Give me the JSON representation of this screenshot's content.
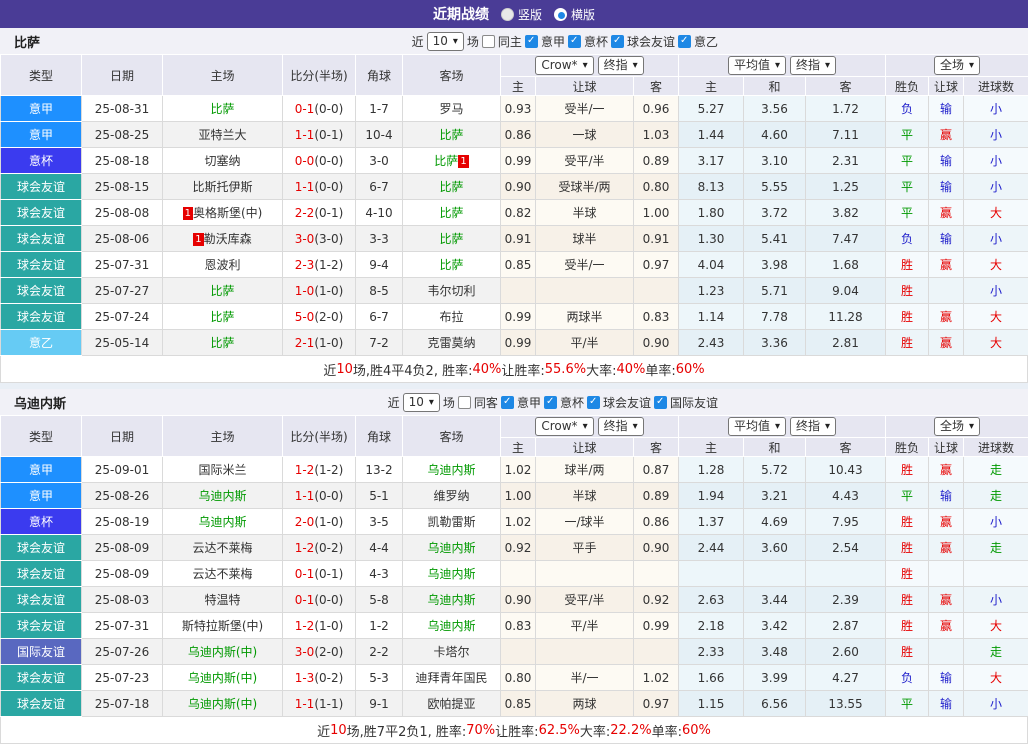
{
  "topbar": {
    "title": "近期战绩",
    "radios": [
      {
        "label": "竖版",
        "checked": false
      },
      {
        "label": "横版",
        "checked": true
      }
    ]
  },
  "league_colors": {
    "意甲": "#1E90FF",
    "意杯": "#3B3BEF",
    "球会友谊": "#2AA7A3",
    "意乙": "#66CBF4",
    "国际友谊": "#5968C0"
  },
  "result_colors": {
    "胜": "#E60000",
    "平": "#009900",
    "负": "#2222CC",
    "赢": "#E60000",
    "输": "#2222CC",
    "大": "#E60000",
    "小": "#2222CC",
    "走": "#009900"
  },
  "table_header": {
    "left_cols": [
      "类型",
      "日期",
      "主场",
      "比分(半场)",
      "角球",
      "客场"
    ],
    "group1": {
      "selects": [
        "Crow*",
        "终指"
      ],
      "cols": [
        "主",
        "让球",
        "客"
      ]
    },
    "group2": {
      "selects": [
        "平均值",
        "终指"
      ],
      "cols": [
        "主",
        "和",
        "客"
      ]
    },
    "group3": {
      "selects": [
        "全场"
      ],
      "cols": [
        "胜负",
        "让球",
        "进球数"
      ]
    }
  },
  "sections": [
    {
      "team": "比萨",
      "filter": {
        "near_label": "近",
        "count": "10",
        "games_label": "场",
        "same": {
          "label": "同主",
          "checked": false
        },
        "leagues": [
          {
            "label": "意甲",
            "checked": true
          },
          {
            "label": "意杯",
            "checked": true
          },
          {
            "label": "球会友谊",
            "checked": true
          },
          {
            "label": "意乙",
            "checked": true
          }
        ]
      },
      "rows": [
        {
          "league": "意甲",
          "date": "25-08-31",
          "home": {
            "name": "比萨",
            "green": true
          },
          "score": "0-1",
          "half": "(0-0)",
          "corner": "1-7",
          "away": {
            "name": "罗马",
            "green": false
          },
          "odds": [
            "0.93",
            "受半/一",
            "0.96"
          ],
          "avg": [
            "5.27",
            "3.56",
            "1.72"
          ],
          "results": [
            "负",
            "输",
            "小"
          ]
        },
        {
          "league": "意甲",
          "date": "25-08-25",
          "home": {
            "name": "亚特兰大",
            "green": false
          },
          "score": "1-1",
          "half": "(0-1)",
          "corner": "10-4",
          "away": {
            "name": "比萨",
            "green": true
          },
          "odds": [
            "0.86",
            "一球",
            "1.03"
          ],
          "avg": [
            "1.44",
            "4.60",
            "7.11"
          ],
          "results": [
            "平",
            "赢",
            "小"
          ]
        },
        {
          "league": "意杯",
          "date": "25-08-18",
          "home": {
            "name": "切塞纳",
            "green": false
          },
          "score": "0-0",
          "half": "(0-0)",
          "corner": "3-0",
          "away": {
            "name": "比萨",
            "green": true,
            "badge_after": "1"
          },
          "odds": [
            "0.99",
            "受平/半",
            "0.89"
          ],
          "avg": [
            "3.17",
            "3.10",
            "2.31"
          ],
          "results": [
            "平",
            "输",
            "小"
          ]
        },
        {
          "league": "球会友谊",
          "date": "25-08-15",
          "home": {
            "name": "比斯托伊斯",
            "green": false
          },
          "score": "1-1",
          "half": "(0-0)",
          "corner": "6-7",
          "away": {
            "name": "比萨",
            "green": true
          },
          "odds": [
            "0.90",
            "受球半/两",
            "0.80"
          ],
          "avg": [
            "8.13",
            "5.55",
            "1.25"
          ],
          "results": [
            "平",
            "输",
            "小"
          ]
        },
        {
          "league": "球会友谊",
          "date": "25-08-08",
          "home": {
            "name": "奥格斯堡(中)",
            "green": false,
            "badge_before": "1"
          },
          "score": "2-2",
          "half": "(0-1)",
          "corner": "4-10",
          "away": {
            "name": "比萨",
            "green": true
          },
          "odds": [
            "0.82",
            "半球",
            "1.00"
          ],
          "avg": [
            "1.80",
            "3.72",
            "3.82"
          ],
          "results": [
            "平",
            "赢",
            "大"
          ]
        },
        {
          "league": "球会友谊",
          "date": "25-08-06",
          "home": {
            "name": "勒沃库森",
            "green": false,
            "badge_before": "1"
          },
          "score": "3-0",
          "half": "(3-0)",
          "corner": "3-3",
          "away": {
            "name": "比萨",
            "green": true
          },
          "odds": [
            "0.91",
            "球半",
            "0.91"
          ],
          "avg": [
            "1.30",
            "5.41",
            "7.47"
          ],
          "results": [
            "负",
            "输",
            "小"
          ]
        },
        {
          "league": "球会友谊",
          "date": "25-07-31",
          "home": {
            "name": "恩波利",
            "green": false
          },
          "score": "2-3",
          "half": "(1-2)",
          "corner": "9-4",
          "away": {
            "name": "比萨",
            "green": true
          },
          "odds": [
            "0.85",
            "受半/一",
            "0.97"
          ],
          "avg": [
            "4.04",
            "3.98",
            "1.68"
          ],
          "results": [
            "胜",
            "赢",
            "大"
          ]
        },
        {
          "league": "球会友谊",
          "date": "25-07-27",
          "home": {
            "name": "比萨",
            "green": true
          },
          "score": "1-0",
          "half": "(1-0)",
          "corner": "8-5",
          "away": {
            "name": "韦尔切利",
            "green": false
          },
          "odds": [
            "",
            "",
            ""
          ],
          "avg": [
            "1.23",
            "5.71",
            "9.04"
          ],
          "results": [
            "胜",
            "",
            "小"
          ]
        },
        {
          "league": "球会友谊",
          "date": "25-07-24",
          "home": {
            "name": "比萨",
            "green": true
          },
          "score": "5-0",
          "half": "(2-0)",
          "corner": "6-7",
          "away": {
            "name": "布拉",
            "green": false
          },
          "odds": [
            "0.99",
            "两球半",
            "0.83"
          ],
          "avg": [
            "1.14",
            "7.78",
            "11.28"
          ],
          "results": [
            "胜",
            "赢",
            "大"
          ]
        },
        {
          "league": "意乙",
          "date": "25-05-14",
          "home": {
            "name": "比萨",
            "green": true
          },
          "score": "2-1",
          "half": "(1-0)",
          "corner": "7-2",
          "away": {
            "name": "克雷莫纳",
            "green": false
          },
          "odds": [
            "0.99",
            "平/半",
            "0.90"
          ],
          "avg": [
            "2.43",
            "3.36",
            "2.81"
          ],
          "results": [
            "胜",
            "赢",
            "大"
          ]
        }
      ],
      "summary": [
        {
          "t": "近",
          "c": "k"
        },
        {
          "t": "10",
          "c": "r"
        },
        {
          "t": "场,胜4平4负2, 胜率:",
          "c": "k"
        },
        {
          "t": "40%",
          "c": "r"
        },
        {
          "t": " 让胜率:",
          "c": "k"
        },
        {
          "t": "55.6%",
          "c": "r"
        },
        {
          "t": " 大率:",
          "c": "k"
        },
        {
          "t": "40%",
          "c": "r"
        },
        {
          "t": " 单率:",
          "c": "k"
        },
        {
          "t": "60%",
          "c": "r"
        }
      ]
    },
    {
      "team": "乌迪内斯",
      "filter": {
        "near_label": "近",
        "count": "10",
        "games_label": "场",
        "same": {
          "label": "同客",
          "checked": false
        },
        "leagues": [
          {
            "label": "意甲",
            "checked": true
          },
          {
            "label": "意杯",
            "checked": true
          },
          {
            "label": "球会友谊",
            "checked": true
          },
          {
            "label": "国际友谊",
            "checked": true
          }
        ]
      },
      "rows": [
        {
          "league": "意甲",
          "date": "25-09-01",
          "home": {
            "name": "国际米兰",
            "green": false
          },
          "score": "1-2",
          "half": "(1-2)",
          "corner": "13-2",
          "away": {
            "name": "乌迪内斯",
            "green": true
          },
          "odds": [
            "1.02",
            "球半/两",
            "0.87"
          ],
          "avg": [
            "1.28",
            "5.72",
            "10.43"
          ],
          "results": [
            "胜",
            "赢",
            "走"
          ]
        },
        {
          "league": "意甲",
          "date": "25-08-26",
          "home": {
            "name": "乌迪内斯",
            "green": true
          },
          "score": "1-1",
          "half": "(0-0)",
          "corner": "5-1",
          "away": {
            "name": "维罗纳",
            "green": false
          },
          "odds": [
            "1.00",
            "半球",
            "0.89"
          ],
          "avg": [
            "1.94",
            "3.21",
            "4.43"
          ],
          "results": [
            "平",
            "输",
            "走"
          ]
        },
        {
          "league": "意杯",
          "date": "25-08-19",
          "home": {
            "name": "乌迪内斯",
            "green": true
          },
          "score": "2-0",
          "half": "(1-0)",
          "corner": "3-5",
          "away": {
            "name": "凯勒雷斯",
            "green": false
          },
          "odds": [
            "1.02",
            "一/球半",
            "0.86"
          ],
          "avg": [
            "1.37",
            "4.69",
            "7.95"
          ],
          "results": [
            "胜",
            "赢",
            "小"
          ]
        },
        {
          "league": "球会友谊",
          "date": "25-08-09",
          "home": {
            "name": "云达不莱梅",
            "green": false
          },
          "score": "1-2",
          "half": "(0-2)",
          "corner": "4-4",
          "away": {
            "name": "乌迪内斯",
            "green": true
          },
          "odds": [
            "0.92",
            "平手",
            "0.90"
          ],
          "avg": [
            "2.44",
            "3.60",
            "2.54"
          ],
          "results": [
            "胜",
            "赢",
            "走"
          ]
        },
        {
          "league": "球会友谊",
          "date": "25-08-09",
          "home": {
            "name": "云达不莱梅",
            "green": false
          },
          "score": "0-1",
          "half": "(0-1)",
          "corner": "4-3",
          "away": {
            "name": "乌迪内斯",
            "green": true
          },
          "odds": [
            "",
            "",
            ""
          ],
          "avg": [
            "",
            "",
            ""
          ],
          "results": [
            "胜",
            "",
            ""
          ]
        },
        {
          "league": "球会友谊",
          "date": "25-08-03",
          "home": {
            "name": "特温特",
            "green": false
          },
          "score": "0-1",
          "half": "(0-0)",
          "corner": "5-8",
          "away": {
            "name": "乌迪内斯",
            "green": true
          },
          "odds": [
            "0.90",
            "受平/半",
            "0.92"
          ],
          "avg": [
            "2.63",
            "3.44",
            "2.39"
          ],
          "results": [
            "胜",
            "赢",
            "小"
          ]
        },
        {
          "league": "球会友谊",
          "date": "25-07-31",
          "home": {
            "name": "斯特拉斯堡(中)",
            "green": false
          },
          "score": "1-2",
          "half": "(1-0)",
          "corner": "1-2",
          "away": {
            "name": "乌迪内斯",
            "green": true
          },
          "odds": [
            "0.83",
            "平/半",
            "0.99"
          ],
          "avg": [
            "2.18",
            "3.42",
            "2.87"
          ],
          "results": [
            "胜",
            "赢",
            "大"
          ]
        },
        {
          "league": "国际友谊",
          "date": "25-07-26",
          "home": {
            "name": "乌迪内斯(中)",
            "green": true
          },
          "score": "3-0",
          "half": "(2-0)",
          "corner": "2-2",
          "away": {
            "name": "卡塔尔",
            "green": false
          },
          "odds": [
            "",
            "",
            ""
          ],
          "avg": [
            "2.33",
            "3.48",
            "2.60"
          ],
          "results": [
            "胜",
            "",
            "走"
          ]
        },
        {
          "league": "球会友谊",
          "date": "25-07-23",
          "home": {
            "name": "乌迪内斯(中)",
            "green": true
          },
          "score": "1-3",
          "half": "(0-2)",
          "corner": "5-3",
          "away": {
            "name": "迪拜青年国民",
            "green": false
          },
          "odds": [
            "0.80",
            "半/一",
            "1.02"
          ],
          "avg": [
            "1.66",
            "3.99",
            "4.27"
          ],
          "results": [
            "负",
            "输",
            "大"
          ]
        },
        {
          "league": "球会友谊",
          "date": "25-07-18",
          "home": {
            "name": "乌迪内斯(中)",
            "green": true
          },
          "score": "1-1",
          "half": "(1-1)",
          "corner": "9-1",
          "away": {
            "name": "欧帕提亚",
            "green": false
          },
          "odds": [
            "0.85",
            "两球",
            "0.97"
          ],
          "avg": [
            "1.15",
            "6.56",
            "13.55"
          ],
          "results": [
            "平",
            "输",
            "小"
          ]
        }
      ],
      "summary": [
        {
          "t": "近",
          "c": "k"
        },
        {
          "t": "10",
          "c": "r"
        },
        {
          "t": "场,胜7平2负1, 胜率:",
          "c": "k"
        },
        {
          "t": "70%",
          "c": "r"
        },
        {
          "t": " 让胜率:",
          "c": "k"
        },
        {
          "t": "62.5%",
          "c": "r"
        },
        {
          "t": " 大率:",
          "c": "k"
        },
        {
          "t": "22.2%",
          "c": "r"
        },
        {
          "t": " 单率:",
          "c": "k"
        },
        {
          "t": "60%",
          "c": "r"
        }
      ]
    }
  ]
}
